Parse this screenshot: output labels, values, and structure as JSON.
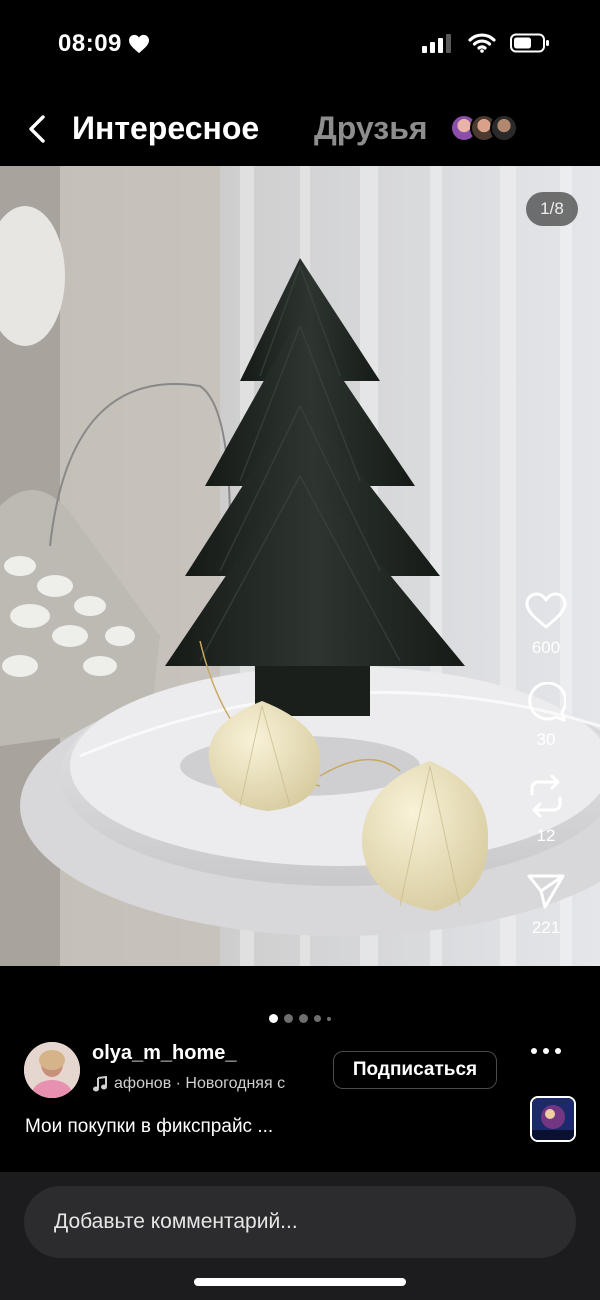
{
  "status": {
    "time": "08:09",
    "icons": [
      "heart-icon",
      "signal-icon",
      "wifi-icon",
      "battery-icon"
    ]
  },
  "header": {
    "back_icon": "chevron-left-icon",
    "tab_active": "Интересное",
    "tab_inactive": "Друзья"
  },
  "post": {
    "page_counter": "1/8",
    "carousel": {
      "total": 5,
      "active": 1
    },
    "likes": "600",
    "comments": "30",
    "reposts": "12",
    "shares": "221",
    "author": "olya_m_home_",
    "music": "афонов · Новогодняя с",
    "subscribe_label": "Подписаться",
    "caption": "Мои покупки в фикспрайс ..."
  },
  "comment": {
    "placeholder": "Добавьте комментарий..."
  },
  "colors": {
    "background": "#000000",
    "inactive_tab": "#8e8e8e",
    "comment_bar": "#1c1c1e",
    "comment_field": "#2c2c2e"
  }
}
